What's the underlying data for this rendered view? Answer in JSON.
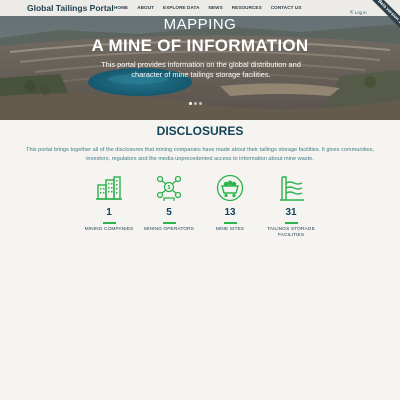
{
  "header": {
    "brand": "Global Tailings Portal",
    "nav": [
      {
        "label": "HOME",
        "name": "nav-home"
      },
      {
        "label": "ABOUT",
        "name": "nav-about"
      },
      {
        "label": "EXPLORE DATA",
        "name": "nav-explore-data"
      },
      {
        "label": "NEWS",
        "name": "nav-news"
      },
      {
        "label": "RESOURCES",
        "name": "nav-resources"
      },
      {
        "label": "CONTACT US",
        "name": "nav-contact-us"
      }
    ],
    "login": "Log in"
  },
  "ribbon": "Beta version 1.0",
  "hero": {
    "kicker": "MAPPING",
    "title": "A MINE OF INFORMATION",
    "subtitle": "This portal provides information on the global distribution and character of mine tailings storage facilities.",
    "active_slide": 1,
    "slide_count": 3
  },
  "disclosures": {
    "title": "DISCLOSURES",
    "description": "This portal brings together all of the disclosures that mining companies have made about their tailings storage facilities. It gives communities, investors, regulators and the media unprecedented access to information about mine waste.",
    "stats": [
      {
        "value": "1",
        "label": "MINING COMPANIES",
        "icon": "buildings-icon"
      },
      {
        "value": "5",
        "label": "MINING OPERATORS",
        "icon": "operators-network-icon"
      },
      {
        "value": "13",
        "label": "MINE SITES",
        "icon": "mine-cart-icon"
      },
      {
        "value": "31",
        "label": "TAILINGS STORAGE FACILITIES",
        "icon": "tailings-dam-icon"
      }
    ]
  },
  "colors": {
    "accent_green": "#2bb34d",
    "heading_navy": "#12445b",
    "body_teal": "#3f7e88"
  }
}
